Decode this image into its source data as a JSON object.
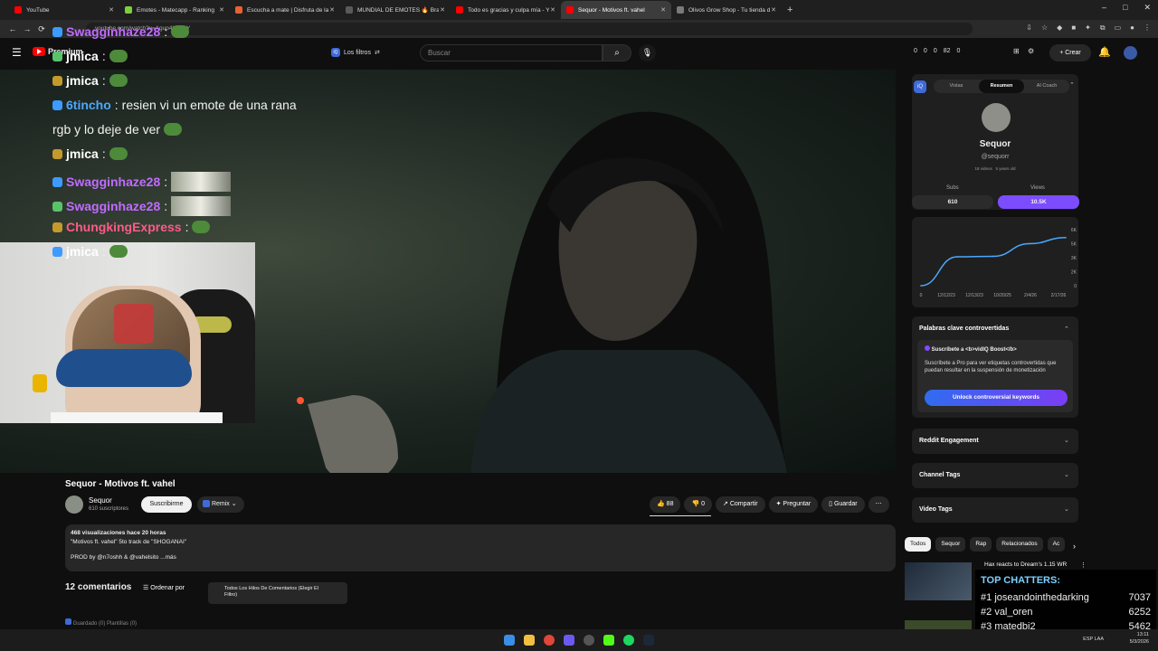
{
  "browser": {
    "tabs": [
      {
        "label": "YouTube",
        "color": "#ff0000"
      },
      {
        "label": "Emotes - Matecapp - Ranking",
        "color": "#7ccf3a"
      },
      {
        "label": "Escucha a mate | Disfruta de la",
        "color": "#e8622e"
      },
      {
        "label": "MUNDIAL DE EMOTES 🔥 Bra",
        "color": "#5a5a5a"
      },
      {
        "label": "Todo es gracias y culpa mía - Y",
        "color": "#ff0000"
      },
      {
        "label": "Sequor - Motivos ft. vahel",
        "color": "#ff0000",
        "active": true
      },
      {
        "label": "Olivos Grow Shop - Tu tienda d",
        "color": "#7a7a7a"
      }
    ],
    "new_tab": "+",
    "url": "youtube.com/watch?v=Agup4tiKCkY"
  },
  "masthead": {
    "menu_icon": "hamburger-icon",
    "logo_label": "Premium",
    "filters_label": "Los filtros",
    "search_placeholder": "Buscar",
    "stats": [
      "0",
      "0",
      "0",
      "82",
      "0"
    ],
    "create_label": "+ Crear"
  },
  "overlay_chat": [
    {
      "name": "Swagginhaze28",
      "color": "#c06cff",
      "sep": ":",
      "top": 0
    },
    {
      "name": "jmica",
      "color": "#ffffff",
      "sep": ":",
      "text": "",
      "top": 1
    },
    {
      "name": "jmica",
      "color": "#ffffff",
      "sep": ":",
      "text": "",
      "top": 2
    },
    {
      "name": "6tincho",
      "color": "#4aa8ff",
      "sep": ":",
      "text": "resien vi un emote de una rana",
      "top": 3
    },
    {
      "name": "",
      "color": "#ffffff",
      "sep": "",
      "text": "rgb y lo deje de ver",
      "top": 4
    },
    {
      "name": "jmica",
      "color": "#ffffff",
      "sep": ":",
      "text": "",
      "top": 5
    },
    {
      "name": "Swagginhaze28",
      "color": "#c06cff",
      "sep": ":",
      "text": "",
      "top": 6
    },
    {
      "name": "Swagginhaze28",
      "color": "#c06cff",
      "sep": ":",
      "text": "",
      "top": 7
    },
    {
      "name": "ChungkingExpress",
      "color": "#ff5a88",
      "sep": ":",
      "text": "",
      "top": 8
    },
    {
      "name": "jmica",
      "color": "#ffffff",
      "sep": ":",
      "text": "",
      "top": 9
    }
  ],
  "video": {
    "title": "Sequor - Motivos ft. vahel",
    "channel": "Sequor",
    "subscribers": "610 suscriptores",
    "subscribe_label": "Suscribirme",
    "remix_label": "Remix",
    "likes": "88",
    "dislikes": "0",
    "share_label": "Compartir",
    "ask_label": "Preguntar",
    "save_label": "Guardar",
    "more_icon": "more-vert-icon",
    "desc_views": "468 visualizaciones  hace 20 horas",
    "desc_line1": "\"Motivos ft. vahel\" 5to track de \"SHOGANAI\"",
    "desc_line2": "PROD by @n7oshh & @vahelsito ...más"
  },
  "comments": {
    "count_label": "12 comentarios",
    "sort_label": "Ordenar por",
    "threads_label": "Todos Los Hilos De Comentarios (Elegir El Filtro)",
    "vidiq_bar": "Guardado (0)   Plantillas (0)"
  },
  "panel": {
    "tabs": [
      "Vistas",
      "Resumen",
      "AI Coach"
    ],
    "active_tab": "Resumen",
    "channel_name": "Sequor",
    "handle": "@sequorr",
    "videos": "18 videos",
    "age": "5 years old",
    "subs_label": "Subs",
    "subs_value": "610",
    "views_label": "Views",
    "views_value": "10.5K",
    "accent": "#7c4dff",
    "keywords_title": "Palabras clave controvertidas",
    "promo_title": "Suscríbete a <b>vidIQ Boost</b>",
    "promo_text": "Suscríbete a Pro para ver etiquetas controvertidas que puedan resultar en la suspensión de monetización",
    "unlock_label": "Unlock controversial keywords",
    "reddit_label": "Reddit Engagement",
    "channel_tags_label": "Channel Tags",
    "video_tags_label": "Video Tags"
  },
  "chart_data": {
    "type": "line",
    "x": [
      "12/12/23",
      "12/13/23",
      "10/20/25",
      "2/4/26",
      "2/17/26"
    ],
    "y_ticks": [
      "6K",
      "5K",
      "3K",
      "2K",
      "0"
    ],
    "values": [
      0,
      3100,
      3150,
      4500,
      5150
    ],
    "ylim": [
      0,
      6000
    ],
    "title": "",
    "xlabel": "",
    "ylabel": ""
  },
  "chips": [
    "Todos",
    "Sequor",
    "Rap",
    "Relacionados",
    "Ac"
  ],
  "next_video": {
    "title": "Hax reacts to Dream's 1.15 WR"
  },
  "top_chatters": {
    "title": "TOP CHATTERS:",
    "rows": [
      {
        "rank": "#1",
        "name": "joseandointhedarking",
        "count": "7037"
      },
      {
        "rank": "#2",
        "name": "val_oren",
        "count": "6252"
      },
      {
        "rank": "#3",
        "name": "matedbi2",
        "count": "5462"
      }
    ]
  },
  "taskbar": {
    "lang": "ESP LAA",
    "time": "13:11",
    "date": "5/3/2026"
  }
}
